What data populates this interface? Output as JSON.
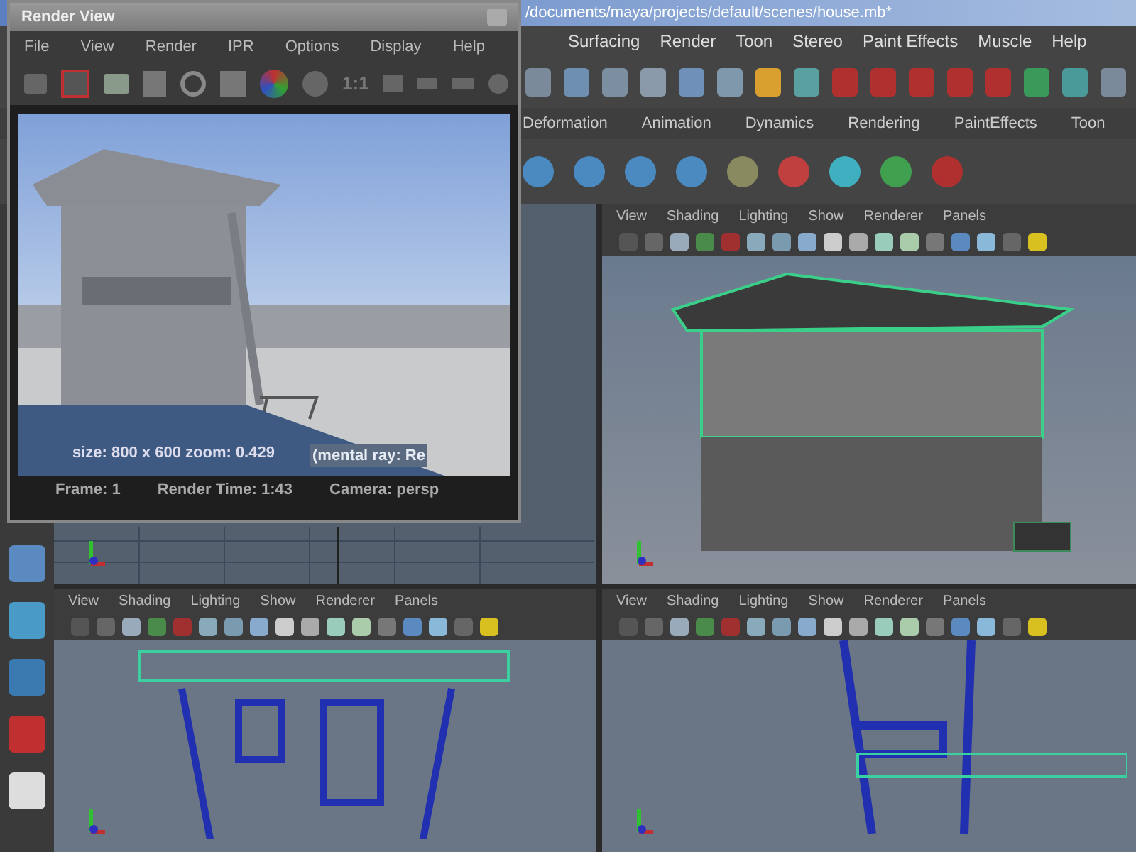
{
  "main_window": {
    "title": "/documents/maya/projects/default/scenes/house.mb*",
    "menus": [
      "Surfacing",
      "Render",
      "Toon",
      "Stereo",
      "Paint Effects",
      "Muscle",
      "Help"
    ],
    "shelf_tabs": [
      "Deformation",
      "Animation",
      "Dynamics",
      "Rendering",
      "PaintEffects",
      "Toon"
    ]
  },
  "panels": [
    {
      "kind": "top"
    },
    {
      "kind": "persp",
      "menus": [
        "View",
        "Shading",
        "Lighting",
        "Show",
        "Renderer",
        "Panels"
      ]
    },
    {
      "kind": "front",
      "menus": [
        "View",
        "Shading",
        "Lighting",
        "Show",
        "Renderer",
        "Panels"
      ]
    },
    {
      "kind": "side",
      "menus": [
        "View",
        "Shading",
        "Lighting",
        "Show",
        "Renderer",
        "Panels"
      ]
    }
  ],
  "render_view": {
    "title": "Render View",
    "menus": [
      "File",
      "View",
      "Render",
      "IPR",
      "Options",
      "Display",
      "Help"
    ],
    "zoom_label": "1:1",
    "image": {
      "info": "size: 800 x 600 zoom: 0.429",
      "renderer": "(mental ray: Re"
    },
    "status": {
      "frame": "Frame: 1",
      "render_time": "Render Time: 1:43",
      "camera": "Camera: persp"
    }
  }
}
